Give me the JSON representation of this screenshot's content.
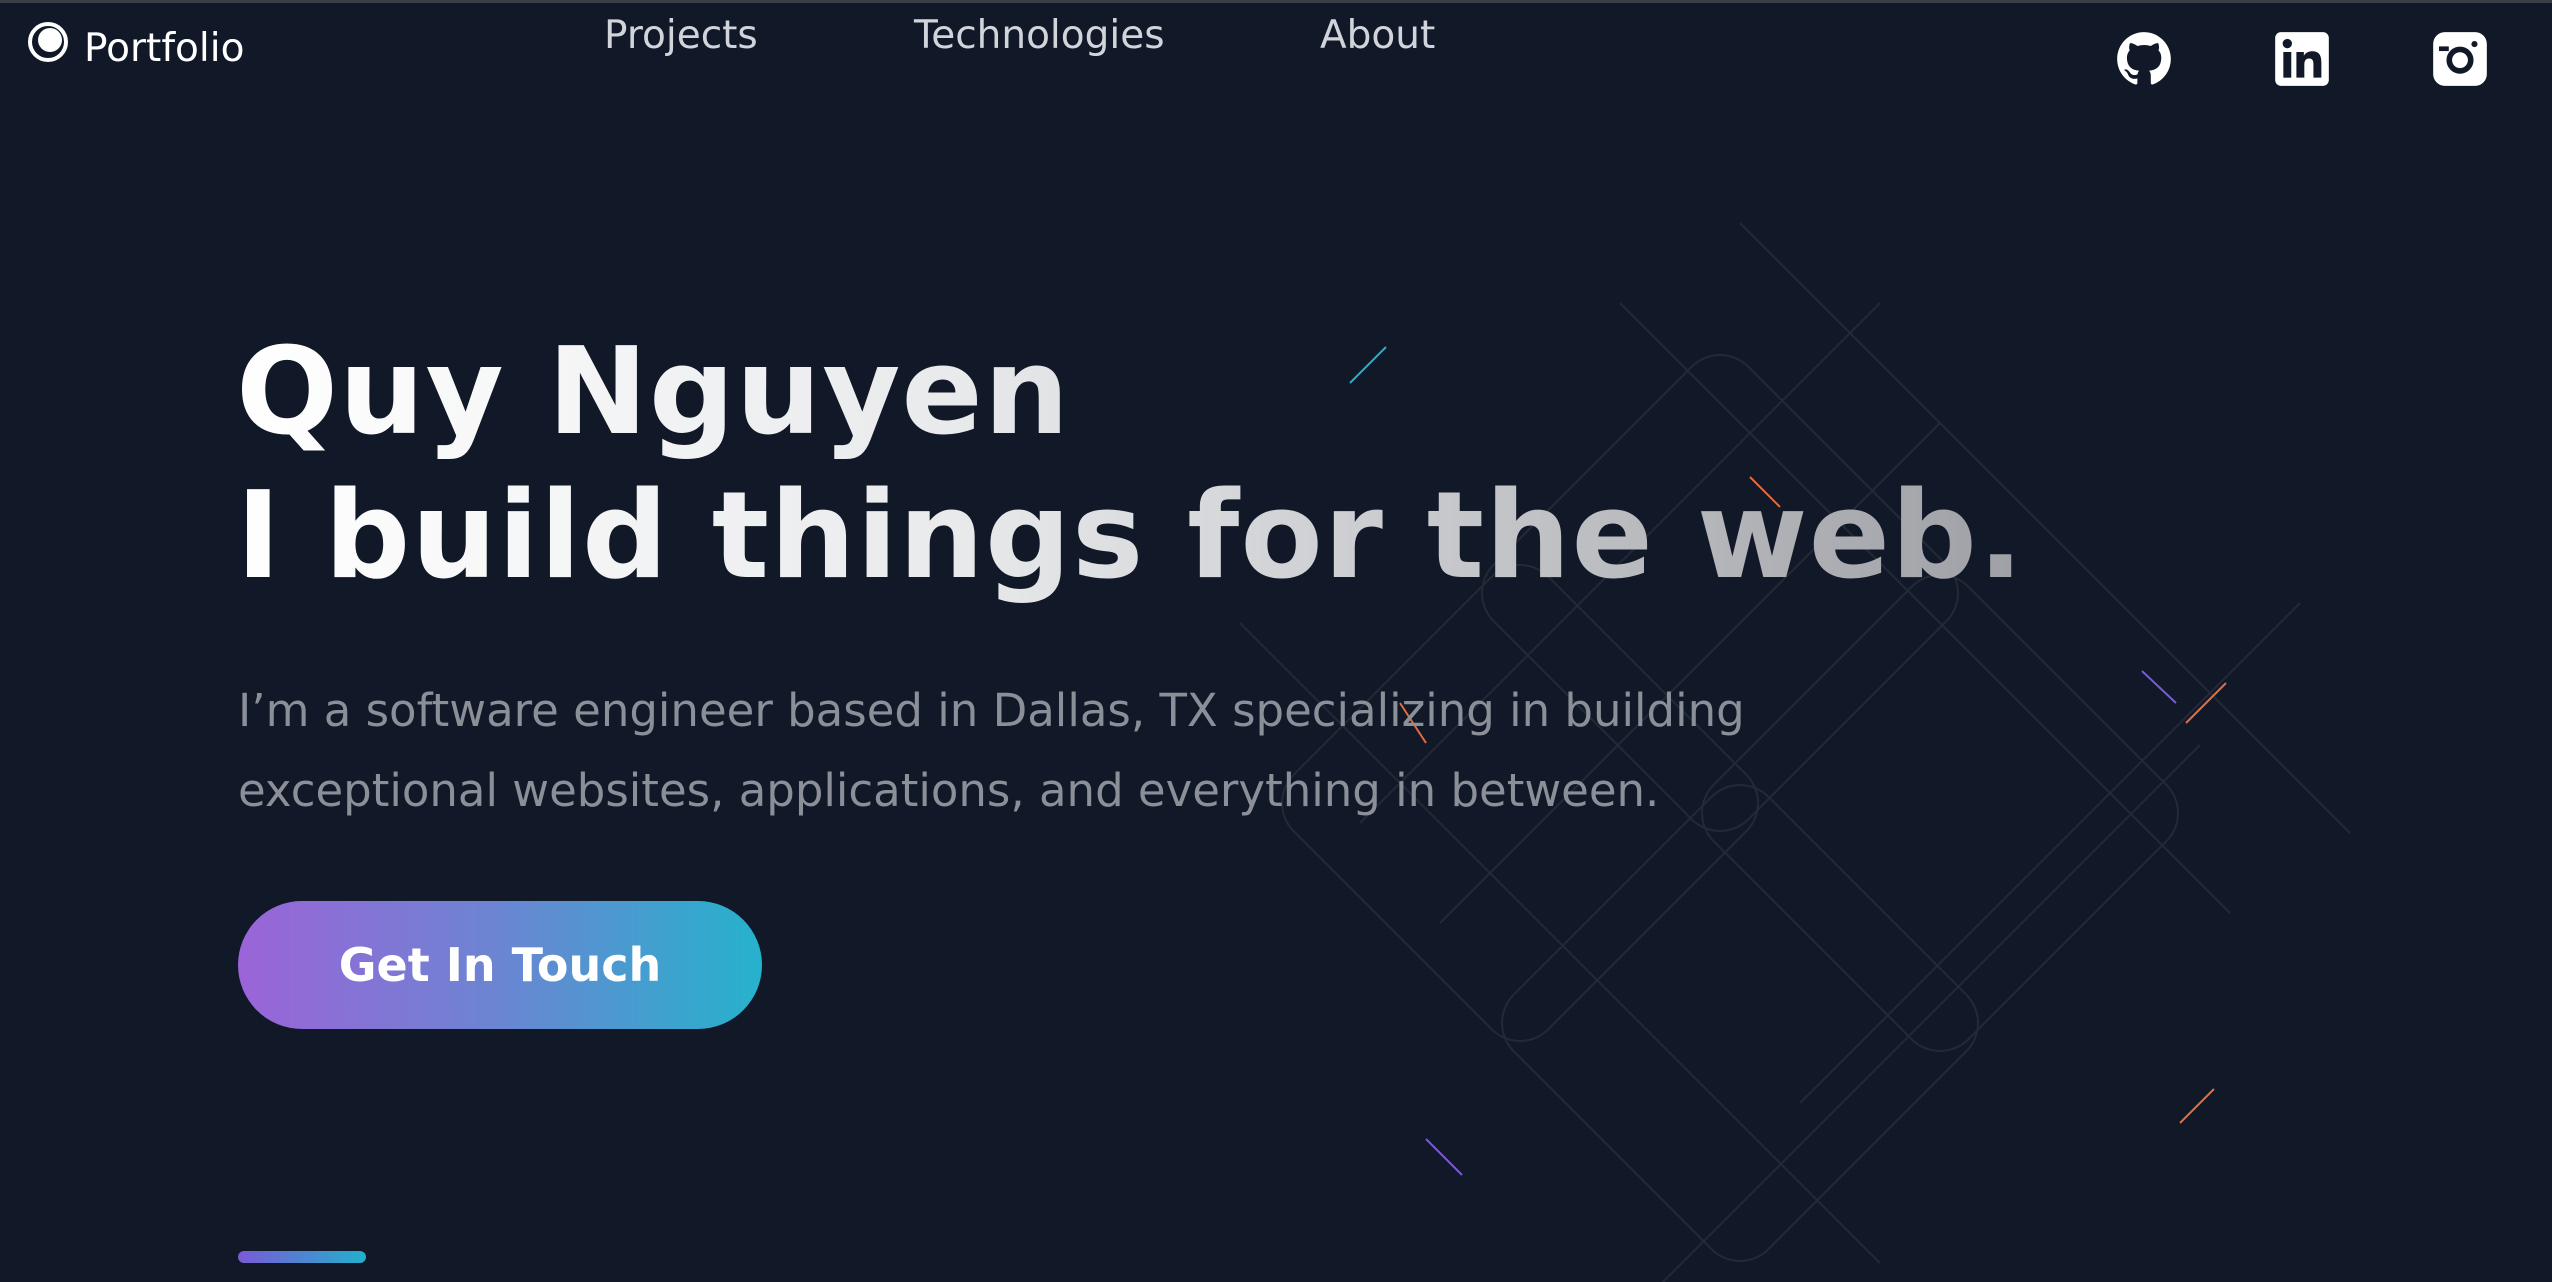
{
  "header": {
    "logo_label": "Portfolio",
    "nav": [
      {
        "label": "Projects"
      },
      {
        "label": "Technologies"
      },
      {
        "label": "About"
      }
    ],
    "social_icons": [
      "github-icon",
      "linkedin-icon",
      "instagram-icon"
    ]
  },
  "hero": {
    "title_line1": "Quy Nguyen",
    "title_line2": "I build things for the web.",
    "description": "I’m a software engineer based in Dallas, TX specializing in building exceptional websites, applications, and everything in between.",
    "cta_label": "Get In Touch"
  },
  "colors": {
    "background": "#111827",
    "nav_text": "#d1d5db",
    "description_text": "#8b8f98",
    "cta_gradient_start": "#9b64d8",
    "cta_gradient_end": "#25b2cc"
  }
}
